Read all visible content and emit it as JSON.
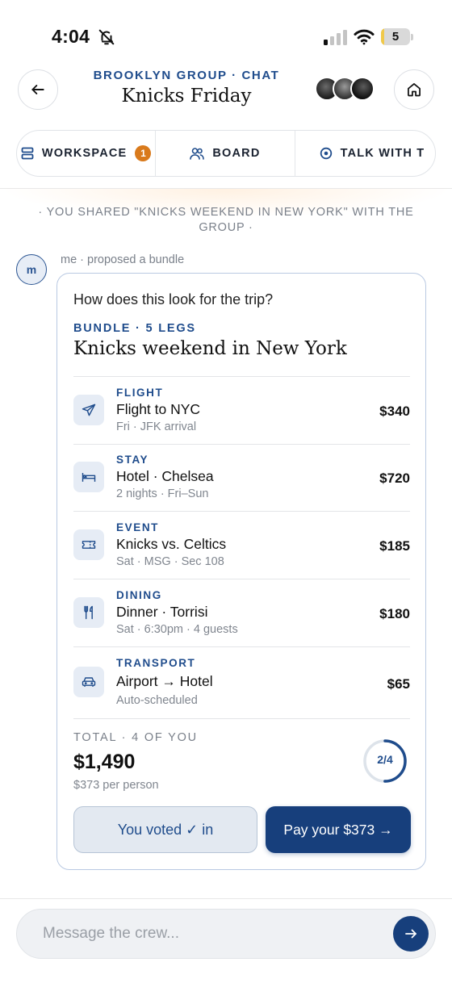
{
  "status_bar": {
    "time": "4:04",
    "battery": "5",
    "battery_level": 0.05,
    "icons": [
      "bell-slash-icon",
      "signal-icon",
      "wifi-icon",
      "battery-icon"
    ]
  },
  "header": {
    "subtitle": "BROOKLYN GROUP · CHAT",
    "title": "Knicks Friday",
    "back_icon": "arrow-left-icon",
    "home_icon": "home-icon",
    "avatars": [
      "member-avatar-1",
      "member-avatar-2",
      "member-avatar-3"
    ]
  },
  "tabs": [
    {
      "label": "WORKSPACE",
      "icon": "stack-icon",
      "badge": "1"
    },
    {
      "label": "BOARD",
      "icon": "people-icon"
    },
    {
      "label": "TALK WITH T",
      "icon": "target-icon"
    }
  ],
  "system_note": "· YOU SHARED \"KNICKS WEEKEND IN NEW YORK\" WITH THE GROUP ·",
  "message": {
    "avatar_initial": "m",
    "meta": "me · proposed a bundle",
    "question": "How does this look for the trip?",
    "bundle_tag": "BUNDLE · 5 LEGS",
    "bundle_title": "Knicks weekend in New York",
    "legs": [
      {
        "category": "FLIGHT",
        "name": "Flight to NYC",
        "sub": "Fri · JFK arrival",
        "price": "$340",
        "icon": "plane-icon"
      },
      {
        "category": "STAY",
        "name": "Hotel · Chelsea",
        "sub": "2 nights · Fri–Sun",
        "price": "$720",
        "icon": "bed-icon"
      },
      {
        "category": "EVENT",
        "name": "Knicks vs. Celtics",
        "sub": "Sat · MSG · Sec 108",
        "price": "$185",
        "icon": "ticket-icon"
      },
      {
        "category": "DINING",
        "name": "Dinner · Torrisi",
        "sub": "Sat · 6:30pm · 4 guests",
        "price": "$180",
        "icon": "utensils-icon"
      },
      {
        "category": "TRANSPORT",
        "name": "Airport → Hotel",
        "sub": "Auto-scheduled",
        "price": "$65",
        "icon": "car-icon"
      }
    ],
    "total_label": "TOTAL · 4 OF YOU",
    "total_amount": "$1,490",
    "per_person": "$373 per person",
    "vote_progress": "2/4",
    "vote_fraction": 0.5,
    "voted_label": "You voted ✓ in",
    "pay_label": "Pay your $373 →"
  },
  "composer": {
    "placeholder": "Message the crew...",
    "send_icon": "arrow-right-icon"
  },
  "colors": {
    "accent": "#1f4c8c",
    "button_dark": "#173f7c",
    "badge": "#d97a1c"
  }
}
